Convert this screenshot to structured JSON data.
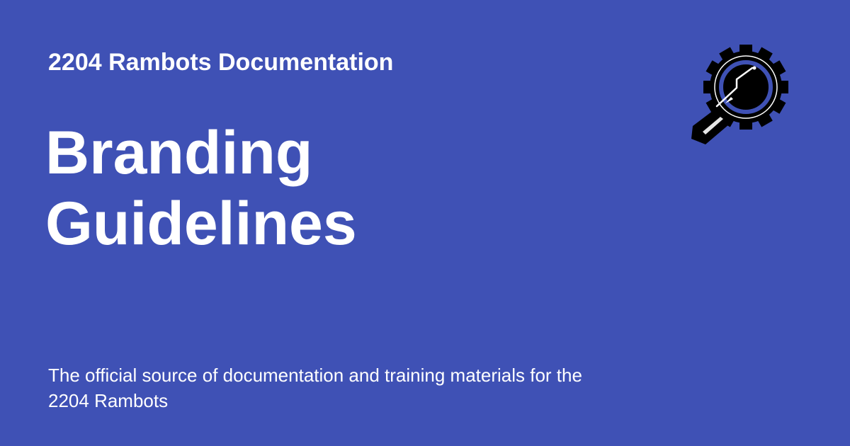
{
  "site": {
    "name": "2204 Rambots Documentation"
  },
  "page": {
    "title_line_1": "Branding",
    "title_line_2": "Guidelines"
  },
  "description": {
    "line_1": "The official source of documentation and training materials for the",
    "line_2": "2204 Rambots"
  },
  "colors": {
    "background": "#3f51b5",
    "text": "#ffffff",
    "logo_dark": "#000000",
    "logo_accent": "#3f51b5"
  },
  "logo": {
    "icon": "rambots-gear-logo-icon"
  }
}
